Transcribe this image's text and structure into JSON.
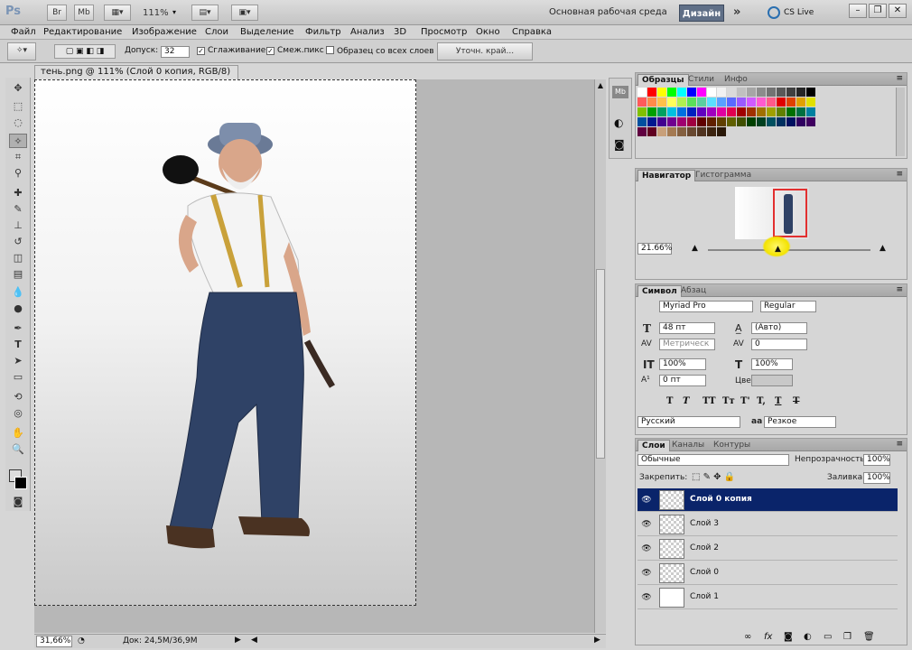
{
  "appbar": {
    "logo": "Ps",
    "buttons": [
      "Br",
      "Mb"
    ],
    "zoom": "111%",
    "workspace": "Основная рабочая среда",
    "design": "Дизайн",
    "more": "»",
    "cslive": "CS Live"
  },
  "menu": [
    "Файл",
    "Редактирование",
    "Изображение",
    "Слои",
    "Выделение",
    "Фильтр",
    "Анализ",
    "3D",
    "Просмотр",
    "Окно",
    "Справка"
  ],
  "options": {
    "tolerance_label": "Допуск:",
    "tolerance_value": "32",
    "antialias": "Сглаживание",
    "contiguous": "Смеж.пикс",
    "sample_all": "Образец со всех слоев",
    "refine_edge": "Уточн. край..."
  },
  "document": {
    "tab_title": "тень.png @ 111% (Слой 0 копия, RGB/8) *",
    "status_zoom": "31,66%",
    "status_doc": "Док: 24,5M/36,9M"
  },
  "tools": [
    "move-icon",
    "marquee-icon",
    "lasso-icon",
    "magic-wand-icon",
    "crop-icon",
    "eyedropper-icon",
    "healing-icon",
    "brush-icon",
    "stamp-icon",
    "history-brush-icon",
    "eraser-icon",
    "gradient-icon",
    "blur-icon",
    "dodge-icon",
    "pen-icon",
    "type-icon",
    "path-select-icon",
    "shape-icon",
    "3d-rotate-icon",
    "3d-orbit-icon",
    "hand-icon",
    "zoom-icon"
  ],
  "swatches_panel": {
    "tabs": [
      "Образцы",
      "Стили",
      "Инфо"
    ],
    "colors": [
      "#ffffff",
      "#ff0000",
      "#ffff00",
      "#00ff00",
      "#00ffff",
      "#0000ff",
      "#ff00ff",
      "#ffffff",
      "#f2f2f2",
      "#dadada",
      "#c0c0c0",
      "#a6a6a6",
      "#8c8c8c",
      "#737373",
      "#595959",
      "#404040",
      "#262626",
      "#000000",
      "#ff5a5a",
      "#ff8a4a",
      "#ffc04a",
      "#ffff5a",
      "#b0f050",
      "#5ae05a",
      "#5ad0a0",
      "#5ae0ff",
      "#5aa0ff",
      "#5a6aff",
      "#9a5aff",
      "#d05aff",
      "#ff5ad0",
      "#ff5a8a",
      "#e00000",
      "#e04000",
      "#e0a000",
      "#e0e000",
      "#80c000",
      "#00a000",
      "#00a060",
      "#00c0e0",
      "#0070e0",
      "#0020c0",
      "#6000c0",
      "#a000c0",
      "#e000a0",
      "#e00050",
      "#a00000",
      "#a03000",
      "#a07000",
      "#a0a000",
      "#608000",
      "#007000",
      "#007040",
      "#0080a0",
      "#0050a0",
      "#001890",
      "#400090",
      "#700090",
      "#a00070",
      "#a00040",
      "#600000",
      "#602000",
      "#604000",
      "#606000",
      "#405000",
      "#004000",
      "#004020",
      "#005060",
      "#003060",
      "#001060",
      "#300060",
      "#400060",
      "#600040",
      "#600020",
      "#c8a07a",
      "#a47a52",
      "#846040",
      "#684830",
      "#503420",
      "#3c2410",
      "#2a1808"
    ]
  },
  "navigator": {
    "tabs": [
      "Навигатор",
      "Гистограмма"
    ],
    "zoom": "21.66%"
  },
  "character": {
    "tabs": [
      "Символ",
      "Абзац"
    ],
    "font_family": "Myriad Pro",
    "font_style": "Regular",
    "size": "48 пт",
    "leading": "(Авто)",
    "kerning": "Метрическ",
    "tracking": "0",
    "vscale": "100%",
    "hscale": "100%",
    "baseline": "0 пт",
    "color_label": "Цвет:",
    "language": "Русский",
    "aa_label": "aa",
    "antialias": "Резкое",
    "format_buttons": [
      "T",
      "T",
      "TT",
      "Tт",
      "T'",
      "T,",
      "T",
      "T"
    ]
  },
  "layers": {
    "tabs": [
      "Слои",
      "Каналы",
      "Контуры"
    ],
    "blend_mode": "Обычные",
    "opacity_label": "Непрозрачность:",
    "opacity": "100%",
    "lock_label": "Закрепить:",
    "fill_label": "Заливка:",
    "fill": "100%",
    "items": [
      {
        "name": "Слой 0 копия"
      },
      {
        "name": "Слой 3"
      },
      {
        "name": "Слой 2"
      },
      {
        "name": "Слой 0"
      },
      {
        "name": "Слой 1"
      }
    ],
    "footer_icons": [
      "link-icon",
      "fx-icon",
      "mask-icon",
      "adjustment-icon",
      "folder-icon",
      "new-layer-icon",
      "trash-icon"
    ],
    "fx_label": "fx"
  }
}
